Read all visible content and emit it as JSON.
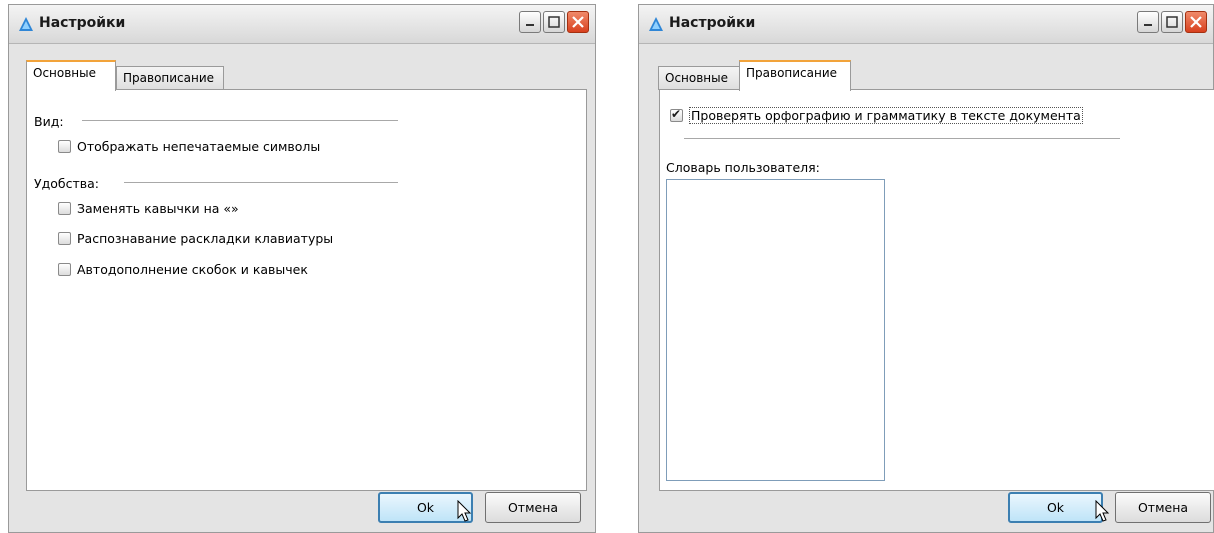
{
  "windows": [
    {
      "title": "Настройки",
      "tabs": [
        "Основные",
        "Правописание"
      ],
      "active_tab": "Основные",
      "groups": [
        {
          "label": "Вид:",
          "options": [
            {
              "label": "Отображать непечатаемые символы",
              "checked": false
            }
          ]
        },
        {
          "label": "Удобства:",
          "options": [
            {
              "label": "Заменять кавычки  на «»",
              "checked": false
            },
            {
              "label": "Распознавание раскладки клавиатуры",
              "checked": false
            },
            {
              "label": "Автодополнение скобок и кавычек",
              "checked": false
            }
          ]
        }
      ],
      "buttons": {
        "ok": "Ok",
        "cancel": "Отмена"
      }
    },
    {
      "title": "Настройки",
      "tabs": [
        "Основные",
        "Правописание"
      ],
      "active_tab": "Правописание",
      "spellcheck_option": {
        "label": "Проверять орфографию и грамматику в тексте документа",
        "checked": true
      },
      "user_dictionary_label": "Словарь пользователя:",
      "user_dictionary_items": [],
      "buttons": {
        "ok": "Ok",
        "cancel": "Отмена"
      }
    }
  ]
}
